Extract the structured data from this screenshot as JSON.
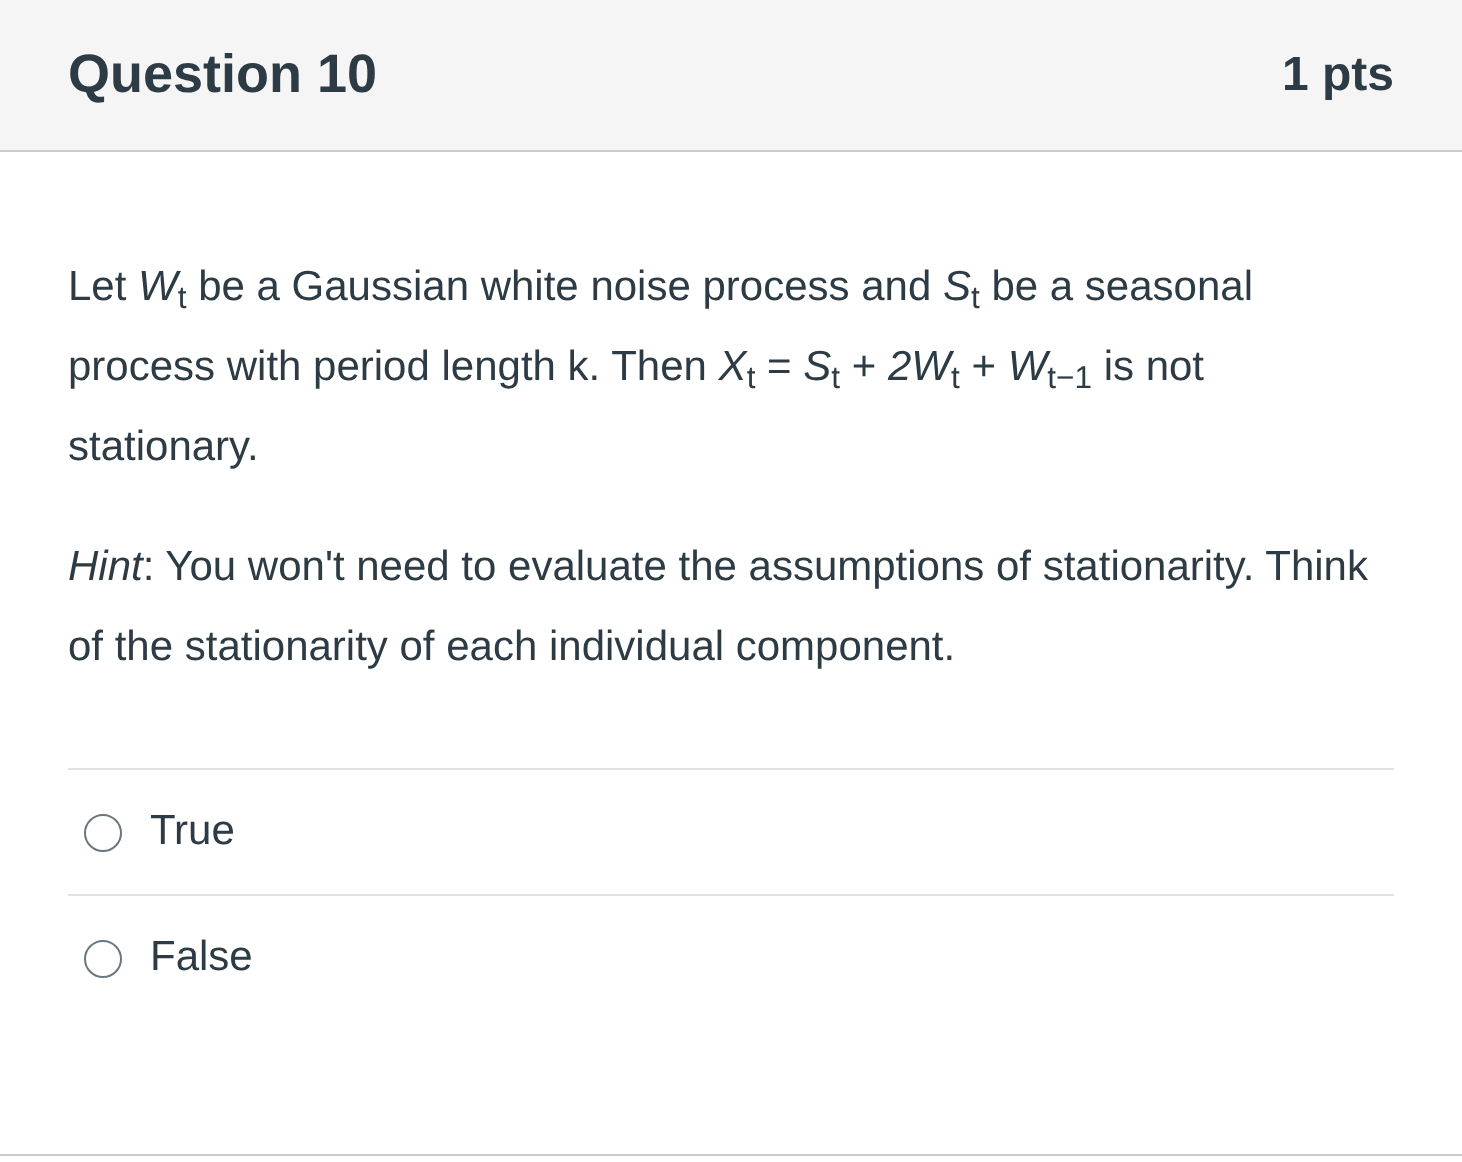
{
  "question": {
    "title": "Question 10",
    "points": "1 pts"
  },
  "paragraphs": [
    "Let *W*$_{t}$  be a Gaussian white noise process and *S*$_{t}$ be a seasonal process with period length k. Then *X*$_{t}$ = *S*$_{t}$ + *2W*$_{t}$ + *W*$_{t−1}$ is not stationary.",
    "*Hint*: You won't need to evaluate the assumptions of stationarity. Think of the stationarity of each individual component."
  ],
  "answers": [
    {
      "label": "True",
      "selected": false
    },
    {
      "label": "False",
      "selected": false
    }
  ]
}
